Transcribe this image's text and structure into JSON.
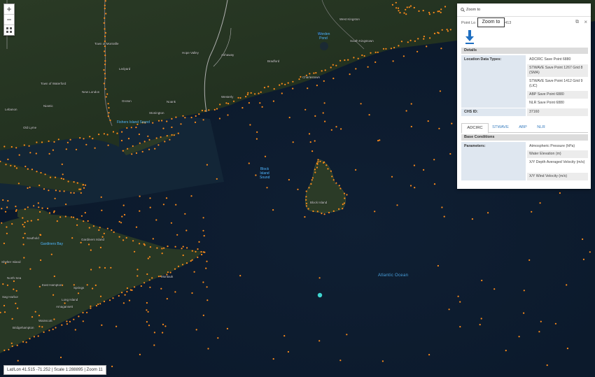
{
  "map": {
    "zoom_in": "+",
    "zoom_out": "−",
    "layers_icon": "grid-icon",
    "labels": [
      {
        "text": "Town of Montville"
      },
      {
        "text": "Town of Waterford"
      },
      {
        "text": "Lebanon"
      },
      {
        "text": "New London"
      },
      {
        "text": "Groton"
      },
      {
        "text": "Westerly"
      },
      {
        "text": "Stonington"
      },
      {
        "text": "Ashaway"
      },
      {
        "text": "Bradford"
      },
      {
        "text": "Charlestown"
      },
      {
        "text": "South Kingstown"
      },
      {
        "text": "West Kingston"
      },
      {
        "text": "Block Island"
      },
      {
        "text": "Montauk"
      },
      {
        "text": "Long Island"
      },
      {
        "text": "Springs"
      },
      {
        "text": "Sag Harbor"
      },
      {
        "text": "East Hampton"
      },
      {
        "text": "Gardiners Island"
      },
      {
        "text": "Shelter Island"
      },
      {
        "text": "Amagansett"
      },
      {
        "text": "Wainscott"
      },
      {
        "text": "Bridgehampton"
      },
      {
        "text": "North Sea"
      },
      {
        "text": "Southold"
      },
      {
        "text": "Noank"
      },
      {
        "text": "Niantic"
      },
      {
        "text": "Old Lyme"
      },
      {
        "text": "Ledyard"
      },
      {
        "text": "Hope Valley"
      }
    ],
    "water_labels": [
      {
        "text": "Fishers Island Sound"
      },
      {
        "text": "Block Island Sound"
      },
      {
        "text": "Gardiners Bay"
      },
      {
        "text": "Worden Pond"
      }
    ],
    "ocean_label": "Atlantic Ocean",
    "status": "Lat/Lon 41.515 -71.252 | Scale 1:288895 | Zoom 11"
  },
  "popup": {
    "zoom_to": "Zoom to",
    "title": "Point Lo",
    "title_suffix": "413",
    "tooltip": "Zoom to",
    "details_header": "Details",
    "location_label": "Location Data Types:",
    "location_values": [
      "ADCIRC Save Point 6880",
      "STWAVE Save Point 1267 Grid 8 (SMA)",
      "STWAVE Save Point 1412 Grid 9 (LIC)",
      "ABP Save Point 6880",
      "NLR Save Point 6880"
    ],
    "chs_label": "CHS ID:",
    "chs_value": "37160",
    "tabs": [
      "ADCIRC",
      "STWAVE",
      "ABP",
      "NLR"
    ],
    "active_tab": "ADCIRC",
    "base_header": "Base Conditions",
    "param_label": "Parameters:",
    "param_values": [
      "Atmospheric Pressure (hPa)",
      "Water Elevation (m)",
      "X/Y Depth Averaged Velocity (m/s)",
      "X/Y Wind Velocity (m/s)"
    ]
  },
  "colors": {
    "save_point": "#ff8c1a",
    "selected_point": "#3fd6d0",
    "ocean": "#0e1c2e",
    "land": "#22301f",
    "link": "#3a7ebf"
  }
}
